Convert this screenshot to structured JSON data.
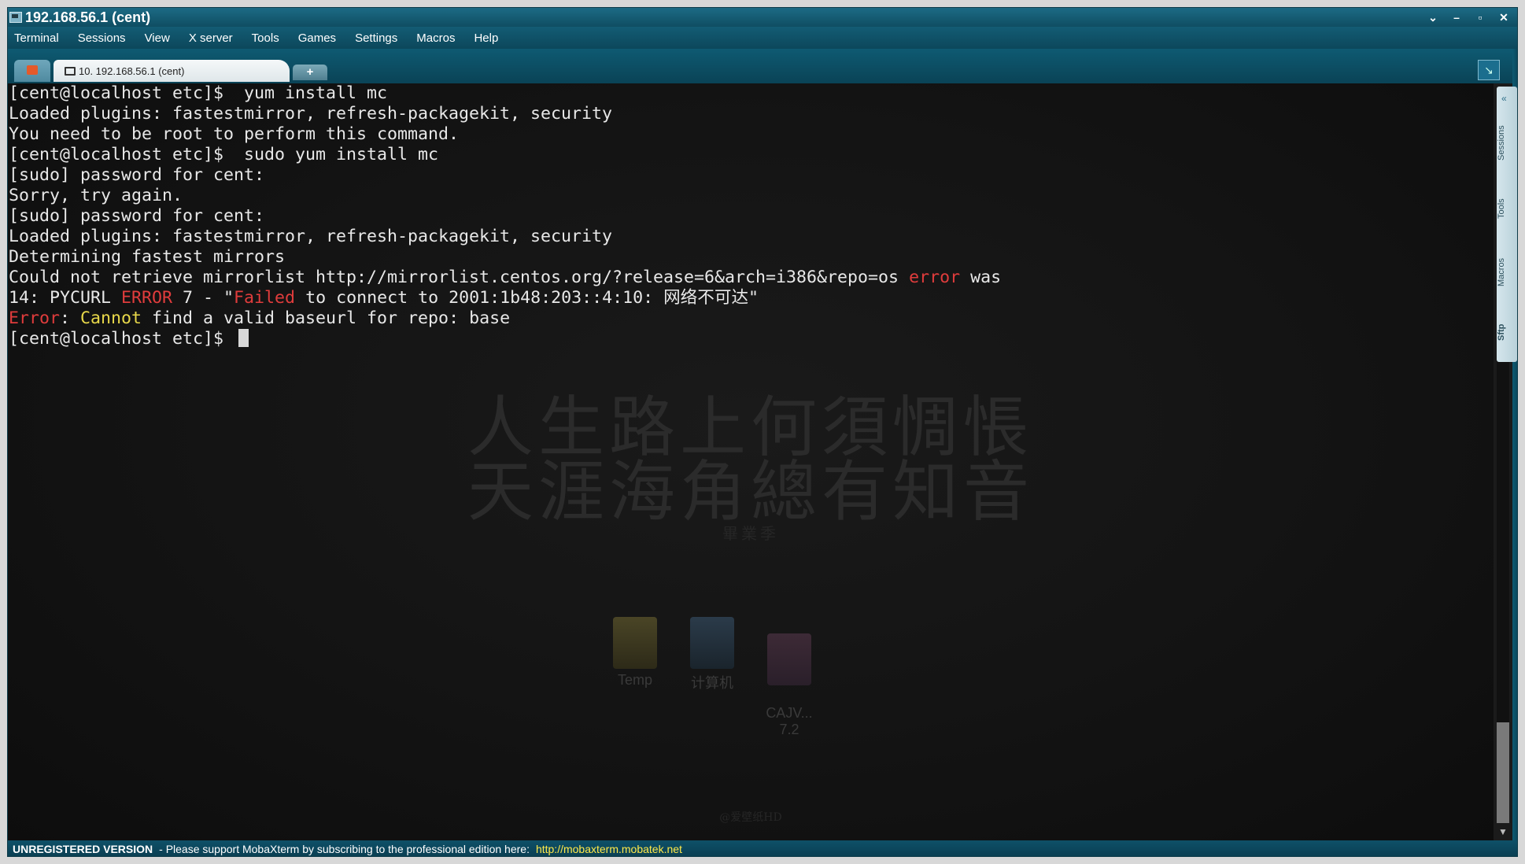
{
  "window": {
    "title": "192.168.56.1 (cent)",
    "controls": [
      "⌄",
      "–",
      "▫",
      "✕"
    ]
  },
  "menu": [
    "Terminal",
    "Sessions",
    "View",
    "X server",
    "Tools",
    "Games",
    "Settings",
    "Macros",
    "Help"
  ],
  "tabs": {
    "session_label": "10. 192.168.56.1 (cent)",
    "add_label": "+"
  },
  "terminal": {
    "lines": [
      [
        {
          "t": "[cent@localhost etc]$  yum install mc"
        }
      ],
      [
        {
          "t": "Loaded plugins: fastestmirror, refresh-packagekit, security"
        }
      ],
      [
        {
          "t": "You need to be root to perform this command."
        }
      ],
      [
        {
          "t": "[cent@localhost etc]$  sudo yum install mc"
        }
      ],
      [
        {
          "t": "[sudo] password for cent:"
        }
      ],
      [
        {
          "t": "Sorry, try again."
        }
      ],
      [
        {
          "t": "[sudo] password for cent:"
        }
      ],
      [
        {
          "t": "Loaded plugins: fastestmirror, refresh-packagekit, security"
        }
      ],
      [
        {
          "t": "Determining fastest mirrors"
        }
      ],
      [
        {
          "t": "Could not retrieve mirrorlist http://mirrorlist.centos.org/?release=6&arch=i386&repo=os "
        },
        {
          "t": "error",
          "c": "red"
        },
        {
          "t": " was"
        }
      ],
      [
        {
          "t": "14: PYCURL "
        },
        {
          "t": "ERROR",
          "c": "red"
        },
        {
          "t": " 7 - \""
        },
        {
          "t": "Failed",
          "c": "red"
        },
        {
          "t": " to connect to 2001:1b48:203::4:10: 网络不可达\""
        }
      ],
      [
        {
          "t": "Error",
          "c": "red"
        },
        {
          "t": ": "
        },
        {
          "t": "Cannot",
          "c": "yellow"
        },
        {
          "t": " find a valid baseurl for repo: base"
        }
      ],
      [
        {
          "t": "[cent@localhost etc]$ "
        },
        {
          "cursor": true
        }
      ]
    ]
  },
  "wallpaper": {
    "line1": "人生路上何須惆悵",
    "line2": "天涯海角總有知音",
    "line3": "畢業季",
    "watermark": "@爱壁纸HD",
    "icons": [
      {
        "label": "Temp",
        "kind": "folder"
      },
      {
        "label": "计算机",
        "kind": "pc"
      },
      {
        "label": "CAJV...\n7.2",
        "kind": "app"
      }
    ]
  },
  "sidebar_tabs": [
    "Sessions",
    "Tools",
    "Macros",
    "Sftp"
  ],
  "statusbar": {
    "unregistered": "UNREGISTERED VERSION",
    "message": " -  Please support MobaXterm by subscribing to the professional edition here:",
    "link": "http://mobaxterm.mobatek.net"
  }
}
